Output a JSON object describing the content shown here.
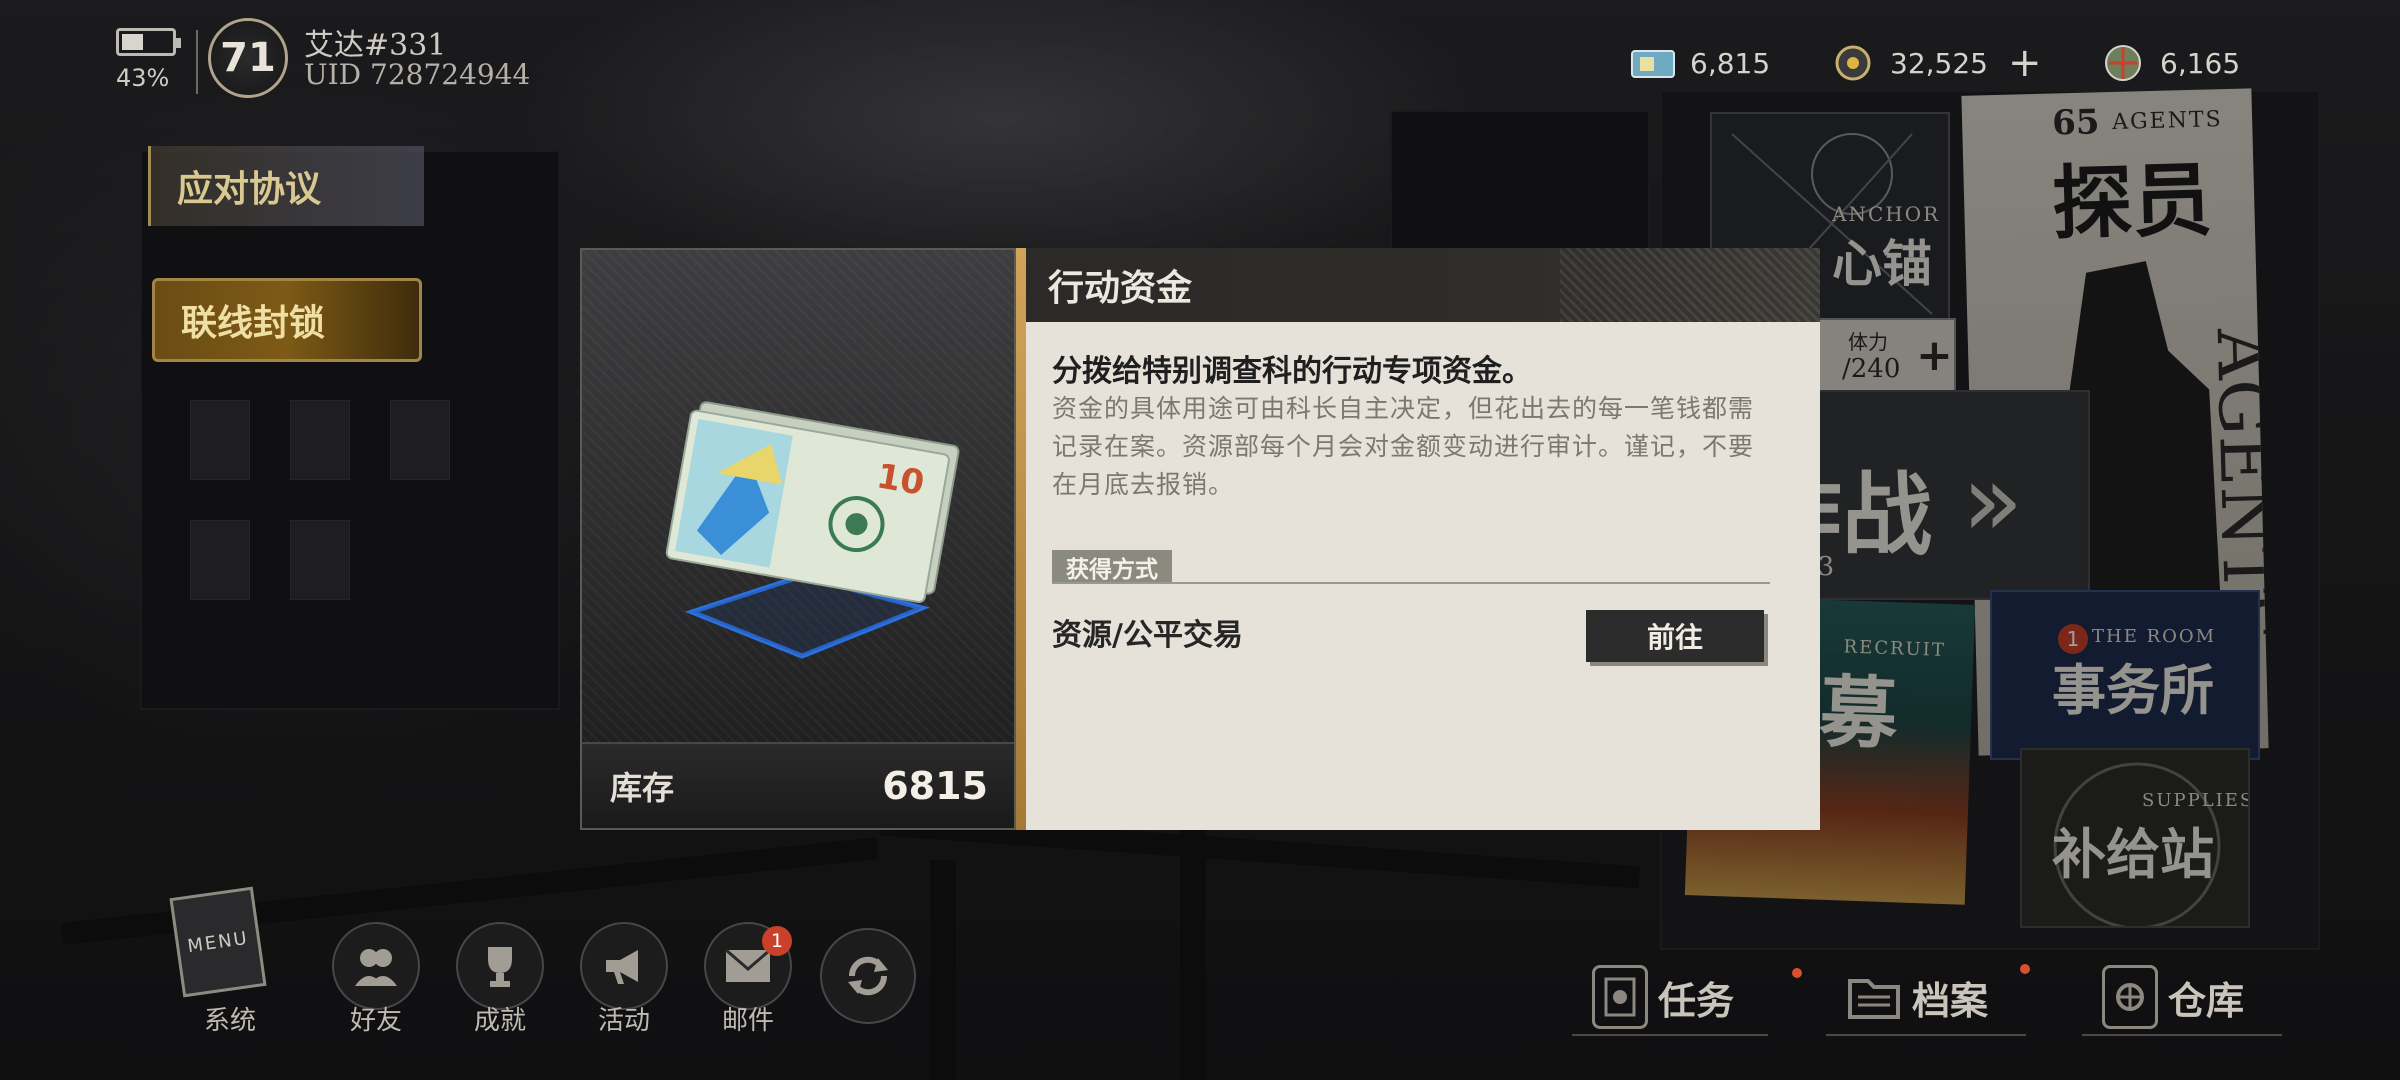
{
  "status": {
    "battery_percent": "43%",
    "battery_level": 0.43,
    "level": "71",
    "player_name": "艾达#331",
    "uid": "UID 728724944"
  },
  "currencies": [
    {
      "icon": "ticket-icon",
      "value": "6,815"
    },
    {
      "icon": "gear-coin-icon",
      "value": "32,525",
      "add_label": "+"
    },
    {
      "icon": "globe-coin-icon",
      "value": "6,165"
    }
  ],
  "left_banners": {
    "protocol": "应对协议",
    "lockdown": "联线封锁"
  },
  "board": {
    "anchor_en": "ANCHOR",
    "anchor_cn": "心锚",
    "agents_count": "65",
    "agents_en": "AGENTS",
    "agents_cn": "探员",
    "stamina_label": "体力",
    "stamina_value": "/240",
    "stamina_plus": "+",
    "battle_cn": "作战",
    "battle_code": "4603",
    "recruit_en": "RECRUIT",
    "recruit_cn": "招募",
    "room_en": "THE ROOM",
    "room_cn": "事务所",
    "room_badge": "1",
    "supplies_en": "SUPPLIES",
    "supplies_cn": "补给站"
  },
  "item_modal": {
    "title": "行动资金",
    "subtitle": "分拨给特别调查科的行动专项资金。",
    "description": "资金的具体用途可由科长自主决定，但花出去的每一笔钱都需记录在案。资源部每个月会对金额变动进行审计。谨记，不要在月底去报销。",
    "stock_label": "库存",
    "stock_value": "6815",
    "acquire_tag": "获得方式",
    "source": "资源/公平交易",
    "goto_label": "前往"
  },
  "bottom_nav": {
    "menu_book": "MENU",
    "system": "系统",
    "friends": "好友",
    "achievements": "成就",
    "events": "活动",
    "mail": "邮件",
    "mail_badge": "1"
  },
  "bottom_right": {
    "tasks": "任务",
    "archive": "档案",
    "storage": "仓库"
  },
  "colors": {
    "accent_gold": "#cfa45a",
    "panel_bg": "#e6e2da",
    "badge_red": "#c9402b"
  }
}
